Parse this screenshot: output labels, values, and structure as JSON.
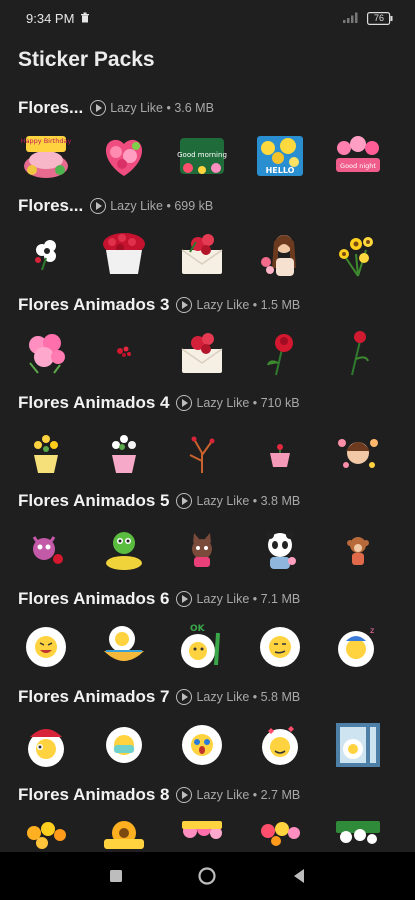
{
  "status": {
    "time": "9:34 PM",
    "battery": "76"
  },
  "header": {
    "title": "Sticker Packs"
  },
  "packs": [
    {
      "name": "Flores...",
      "author": "Lazy Like",
      "size": "3.6 MB"
    },
    {
      "name": "Flores...",
      "author": "Lazy Like",
      "size": "699 kB"
    },
    {
      "name": "Flores Animados 3",
      "author": "Lazy Like",
      "size": "1.5 MB"
    },
    {
      "name": "Flores Animados 4",
      "author": "Lazy Like",
      "size": "710 kB"
    },
    {
      "name": "Flores Animados 5",
      "author": "Lazy Like",
      "size": "3.8 MB"
    },
    {
      "name": "Flores Animados 6",
      "author": "Lazy Like",
      "size": "7.1 MB"
    },
    {
      "name": "Flores Animados 7",
      "author": "Lazy Like",
      "size": "5.8 MB"
    },
    {
      "name": "Flores Animados 8",
      "author": "Lazy Like",
      "size": "2.7 MB"
    }
  ],
  "sticker_texts": {
    "happy_birthday": "Happy Birthday",
    "good_morning": "Good morning",
    "hello": "HELLO",
    "good_night": "Good night",
    "ok": "OK"
  }
}
